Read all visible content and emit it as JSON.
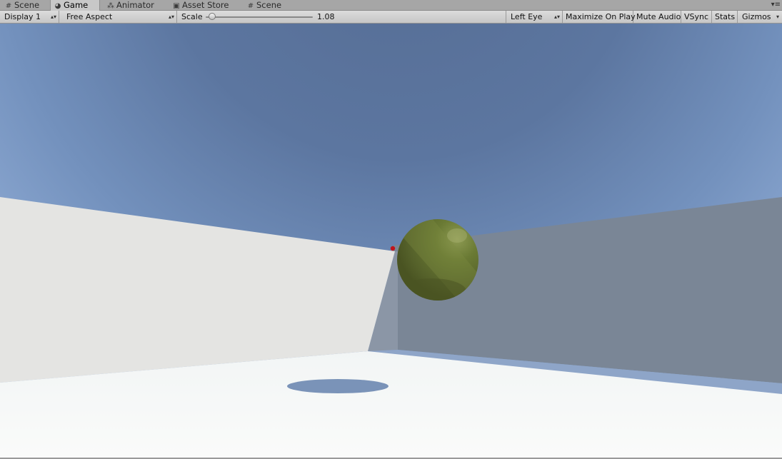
{
  "tabs": [
    {
      "label": "Scene",
      "icon": "grid-icon",
      "active": false
    },
    {
      "label": "Game",
      "icon": "pacman-icon",
      "active": true
    },
    {
      "label": "Animator",
      "icon": "nodes-icon",
      "active": false
    },
    {
      "label": "Asset Store",
      "icon": "store-icon",
      "active": false
    },
    {
      "label": "Scene",
      "icon": "grid-icon",
      "active": false
    }
  ],
  "toolbar": {
    "display": "Display 1",
    "aspect": "Free Aspect",
    "scale_label": "Scale",
    "scale_value": "1.08",
    "eye": "Left Eye",
    "maximize": "Maximize On Play",
    "mute": "Mute Audio",
    "vsync": "VSync",
    "stats": "Stats",
    "gizmos": "Gizmos"
  },
  "colors": {
    "sky_top": "#5a7198",
    "sky_horizon": "#8aa6cf",
    "left_wall": "#e4e4e2",
    "right_wall": "#7a8696",
    "floor": "#f7f9f8",
    "sphere": "#5f6c30",
    "shadow": "#7a93b8",
    "marker": "#c0141c"
  }
}
